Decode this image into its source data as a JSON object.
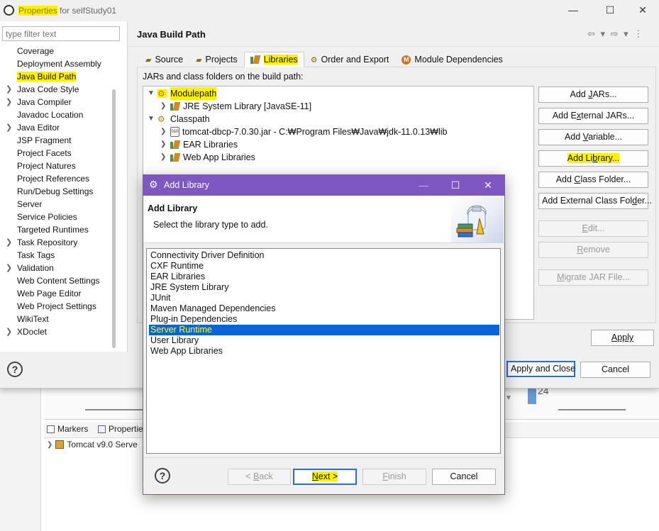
{
  "window": {
    "title_highlight": "Properties",
    "title_rest": " for selfStudy01",
    "controls": {
      "minimize": "—",
      "maximize": "☐",
      "close": "✕"
    }
  },
  "filter": {
    "placeholder": "type filter text"
  },
  "nav": {
    "items": [
      {
        "label": "Coverage",
        "chevron": false
      },
      {
        "label": "Deployment Assembly",
        "chevron": false
      },
      {
        "label": "Java Build Path",
        "chevron": false,
        "selected": true
      },
      {
        "label": "Java Code Style",
        "chevron": true
      },
      {
        "label": "Java Compiler",
        "chevron": true
      },
      {
        "label": "Javadoc Location",
        "chevron": false
      },
      {
        "label": "Java Editor",
        "chevron": true
      },
      {
        "label": "JSP Fragment",
        "chevron": false
      },
      {
        "label": "Project Facets",
        "chevron": false
      },
      {
        "label": "Project Natures",
        "chevron": false
      },
      {
        "label": "Project References",
        "chevron": false
      },
      {
        "label": "Run/Debug Settings",
        "chevron": false
      },
      {
        "label": "Server",
        "chevron": false
      },
      {
        "label": "Service Policies",
        "chevron": false
      },
      {
        "label": "Targeted Runtimes",
        "chevron": false
      },
      {
        "label": "Task Repository",
        "chevron": true
      },
      {
        "label": "Task Tags",
        "chevron": false
      },
      {
        "label": "Validation",
        "chevron": true
      },
      {
        "label": "Web Content Settings",
        "chevron": false
      },
      {
        "label": "Web Page Editor",
        "chevron": false
      },
      {
        "label": "Web Project Settings",
        "chevron": false
      },
      {
        "label": "WikiText",
        "chevron": false
      },
      {
        "label": "XDoclet",
        "chevron": true
      }
    ]
  },
  "page": {
    "title": "Java Build Path",
    "nav_arrows": "⇦ ▾ ⇨ ▾ ⋮"
  },
  "tabs": [
    {
      "label": "Source",
      "icon": "source-folder-icon"
    },
    {
      "label": "Projects",
      "icon": "projects-icon"
    },
    {
      "label": "Libraries",
      "icon": "libraries-icon",
      "active": true
    },
    {
      "label": "Order and Export",
      "icon": "order-export-icon"
    },
    {
      "label": "Module Dependencies",
      "icon": "module-dependencies-icon"
    }
  ],
  "build_path": {
    "label": "JARs and class folders on the build path:",
    "tree": {
      "modulepath": "Modulepath",
      "jre": "JRE System Library [JavaSE-11]",
      "classpath": "Classpath",
      "tomcat_jar": "tomcat-dbcp-7.0.30.jar - C:₩Program Files₩Java₩jdk-11.0.13₩lib",
      "ear": "EAR Libraries",
      "webapp": "Web App Libraries"
    }
  },
  "side_buttons": {
    "add_jars": {
      "pre": "Add ",
      "u": "J",
      "post": "ARs..."
    },
    "add_external_jars": {
      "pre": "Add E",
      "u": "x",
      "post": "ternal JARs..."
    },
    "add_variable": {
      "pre": "Add ",
      "u": "V",
      "post": "ariable..."
    },
    "add_library": {
      "pre": "Add Li",
      "u": "b",
      "post": "rary..."
    },
    "add_class_folder": {
      "pre": "Add ",
      "u": "C",
      "post": "lass Folder..."
    },
    "add_external_class_folder": {
      "pre": "Add External Class Fol",
      "u": "d",
      "post": "er..."
    },
    "edit": {
      "pre": "",
      "u": "E",
      "post": "dit..."
    },
    "remove": {
      "pre": "",
      "u": "R",
      "post": "emove"
    },
    "migrate": {
      "pre": "",
      "u": "M",
      "post": "igrate JAR File..."
    }
  },
  "footer": {
    "apply": "Apply",
    "apply_and_close": "Apply and Close",
    "cancel": "Cancel"
  },
  "dialog": {
    "title": "Add Library",
    "heading": "Add Library",
    "subtitle": "Select the library type to add.",
    "libraries": [
      "Connectivity Driver Definition",
      "CXF Runtime",
      "EAR Libraries",
      "JRE System Library",
      "JUnit",
      "Maven Managed Dependencies",
      "Plug-in Dependencies",
      "Server Runtime",
      "User Library",
      "Web App Libraries"
    ],
    "selected_index": 7,
    "buttons": {
      "back": {
        "pre": "< ",
        "u": "B",
        "post": "ack"
      },
      "next": {
        "pre": "",
        "u": "N",
        "post": "ext >"
      },
      "finish": {
        "pre": "",
        "u": "F",
        "post": "inish"
      },
      "cancel": "Cancel"
    }
  },
  "background": {
    "line_number": "24",
    "tab_markers": "Markers",
    "tab_properties": "Propertie",
    "tree_item": "Tomcat v9.0 Serve"
  },
  "colors": {
    "highlight": "#fff200",
    "dialog_title_bar": "#7e57c2",
    "selection": "#0a64d6"
  }
}
